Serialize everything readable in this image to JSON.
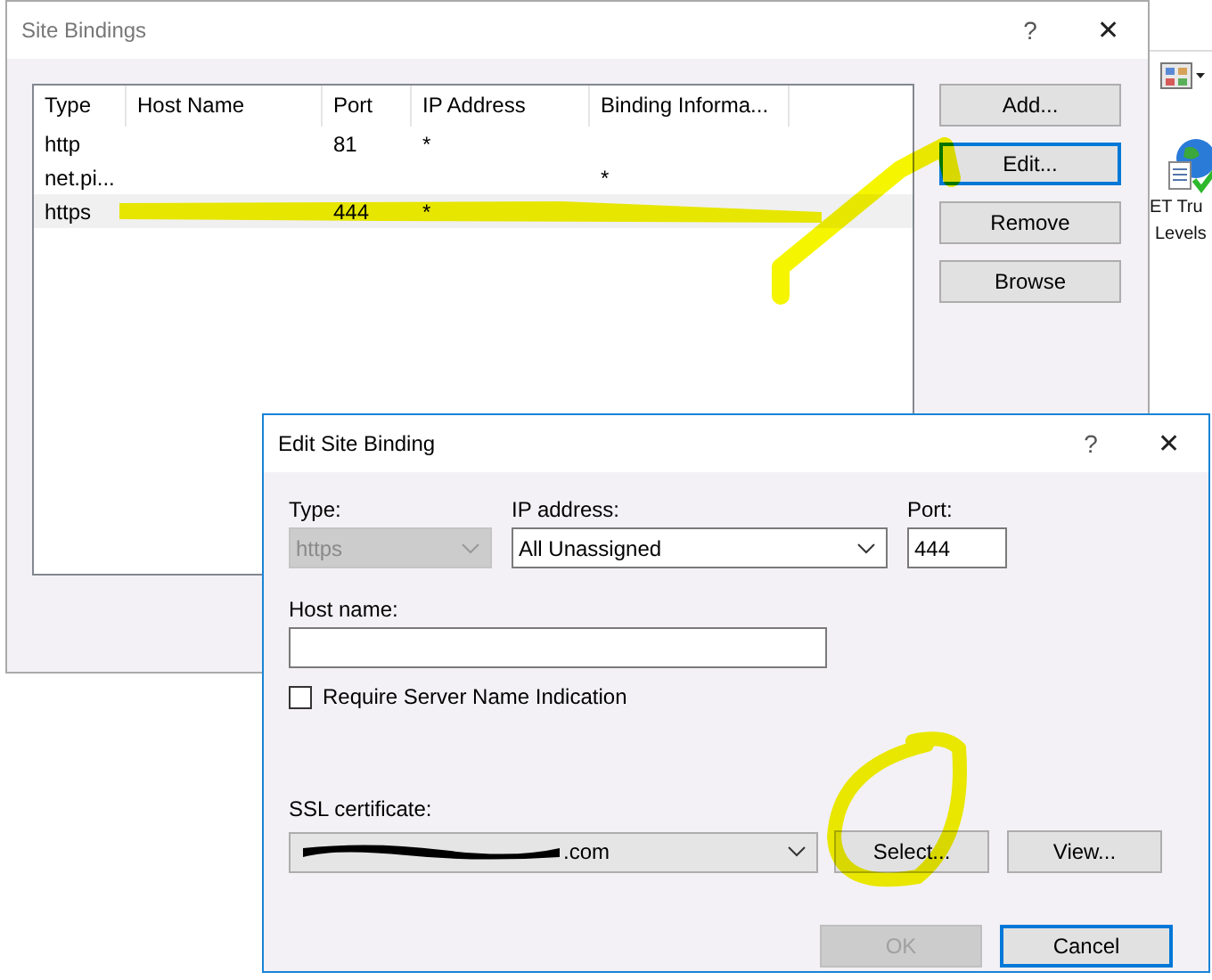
{
  "background": {
    "feature_label": [
      "ET Tru",
      "Levels"
    ]
  },
  "site_bindings": {
    "title": "Site Bindings",
    "help": "?",
    "close": "✕",
    "columns": [
      "Type",
      "Host Name",
      "Port",
      "IP Address",
      "Binding Informa..."
    ],
    "rows": [
      {
        "cells": [
          "http",
          "",
          "81",
          "*",
          ""
        ],
        "selected": false
      },
      {
        "cells": [
          "net.pi...",
          "",
          "",
          "",
          "*"
        ],
        "selected": false
      },
      {
        "cells": [
          "https",
          "",
          "444",
          "*",
          ""
        ],
        "selected": true
      }
    ],
    "buttons": [
      {
        "label": "Add...",
        "focused": false
      },
      {
        "label": "Edit...",
        "focused": true
      },
      {
        "label": "Remove",
        "focused": false
      },
      {
        "label": "Browse",
        "focused": false
      }
    ]
  },
  "edit_site_binding": {
    "title": "Edit Site Binding",
    "help": "?",
    "close": "✕",
    "type": {
      "label": "Type:",
      "value": "https",
      "disabled": true
    },
    "ip_address": {
      "label": "IP address:",
      "value": "All Unassigned",
      "disabled": false
    },
    "port": {
      "label": "Port:",
      "value": "444"
    },
    "host_name": {
      "label": "Host name:"
    },
    "require_sni": {
      "label": "Require Server Name Indication",
      "checked": false
    },
    "ssl_certificate": {
      "label": "SSL certificate:",
      "value": ".com",
      "redacted": true
    },
    "buttons": [
      {
        "label": "Select...",
        "disabled": false,
        "focused": false
      },
      {
        "label": "View...",
        "disabled": false,
        "focused": false
      }
    ],
    "footer_buttons": [
      {
        "label": "OK",
        "disabled": true,
        "focused": false
      },
      {
        "label": "Cancel",
        "disabled": false,
        "focused": true
      }
    ]
  }
}
